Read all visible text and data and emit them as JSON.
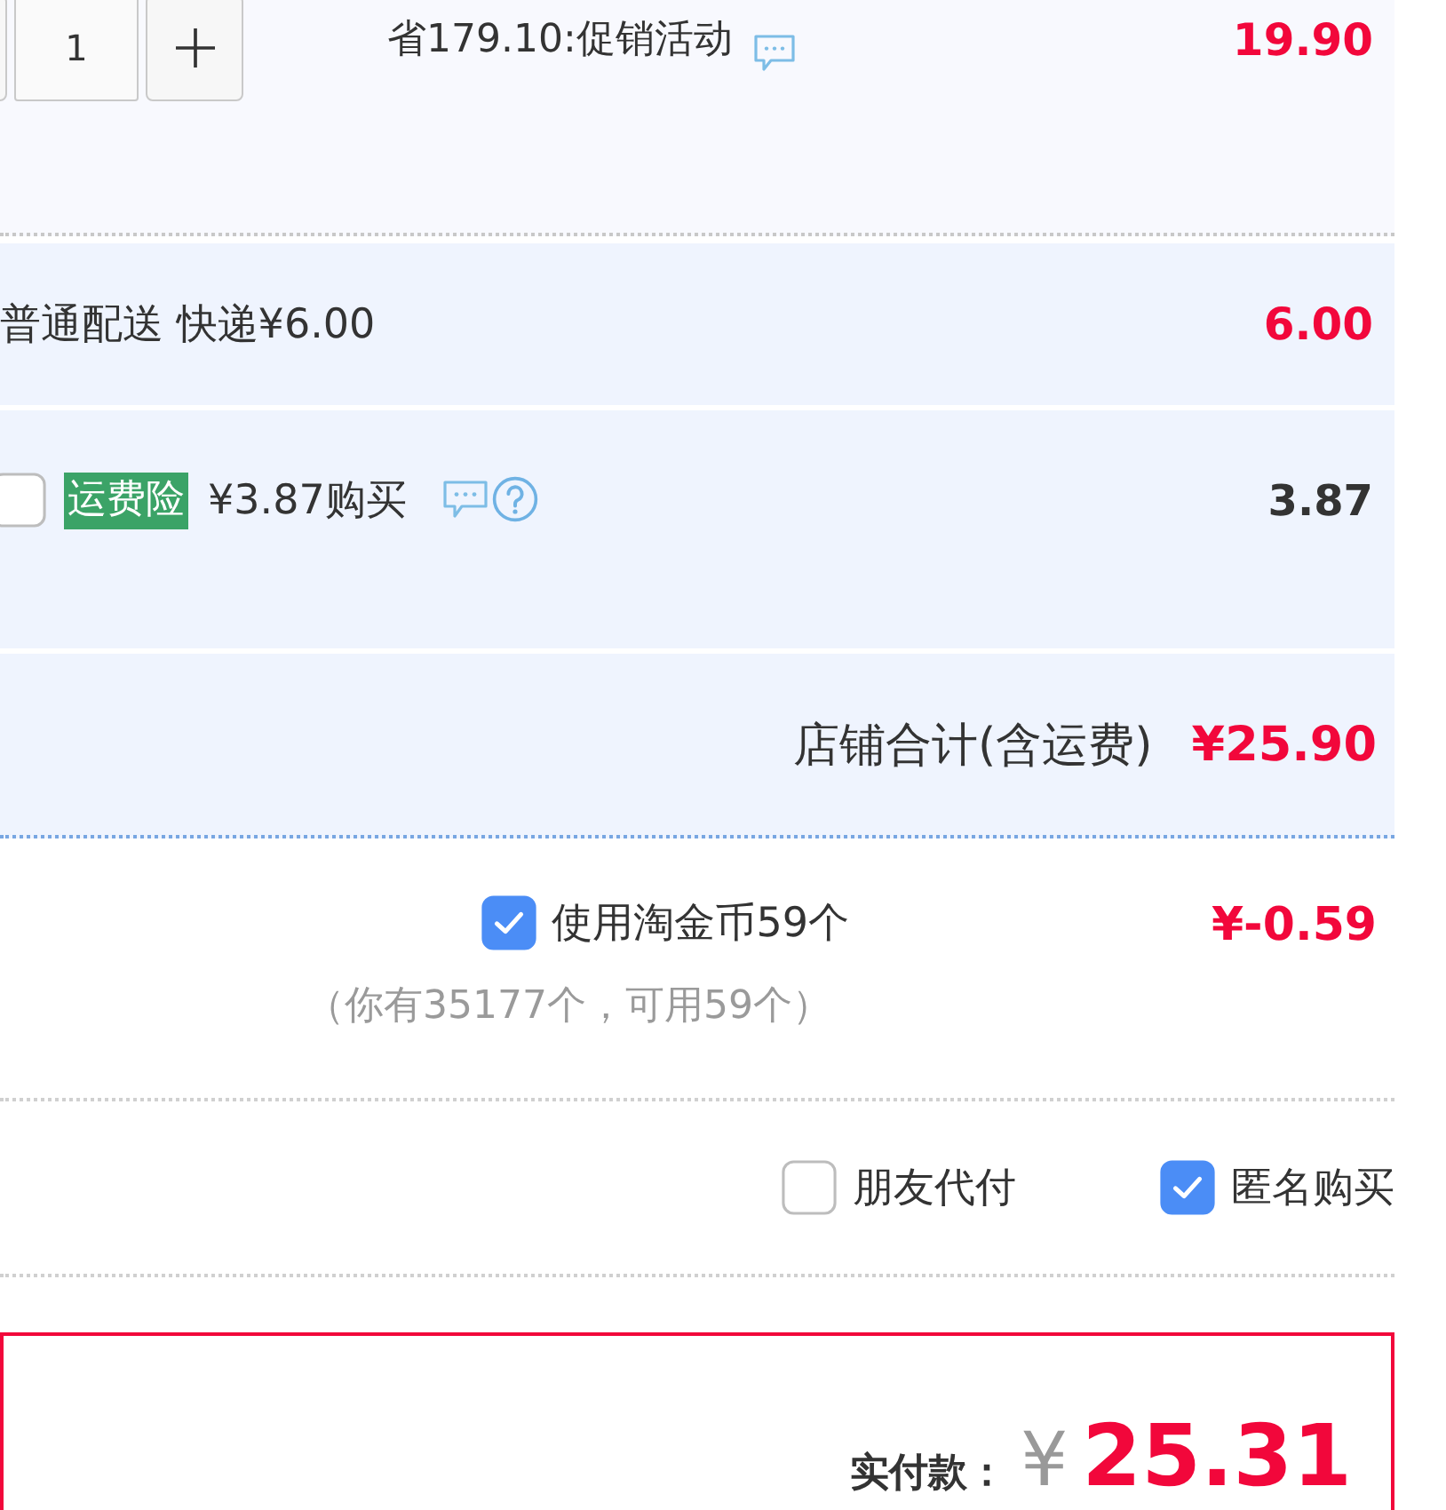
{
  "item": {
    "quantity": "1",
    "promo": "省179.10:促销活动",
    "price": "19.90"
  },
  "shipping": {
    "label": "普通配送 快递¥6.00",
    "amount": "6.00"
  },
  "insurance": {
    "checked": false,
    "tag": "运费险",
    "label": "¥3.87购买",
    "amount": "3.87"
  },
  "store_total": {
    "label": "店铺合计(含运费)",
    "amount": "¥25.90"
  },
  "coins": {
    "checked": true,
    "label": "使用淘金币59个",
    "note": "（你有35177个，可用59个）",
    "amount": "¥-0.59"
  },
  "options": [
    {
      "label": "朋友代付",
      "checked": false
    },
    {
      "label": "匿名购买",
      "checked": true
    }
  ],
  "payment": {
    "label": "实付款：",
    "currency": "¥",
    "amount": "25.31"
  }
}
